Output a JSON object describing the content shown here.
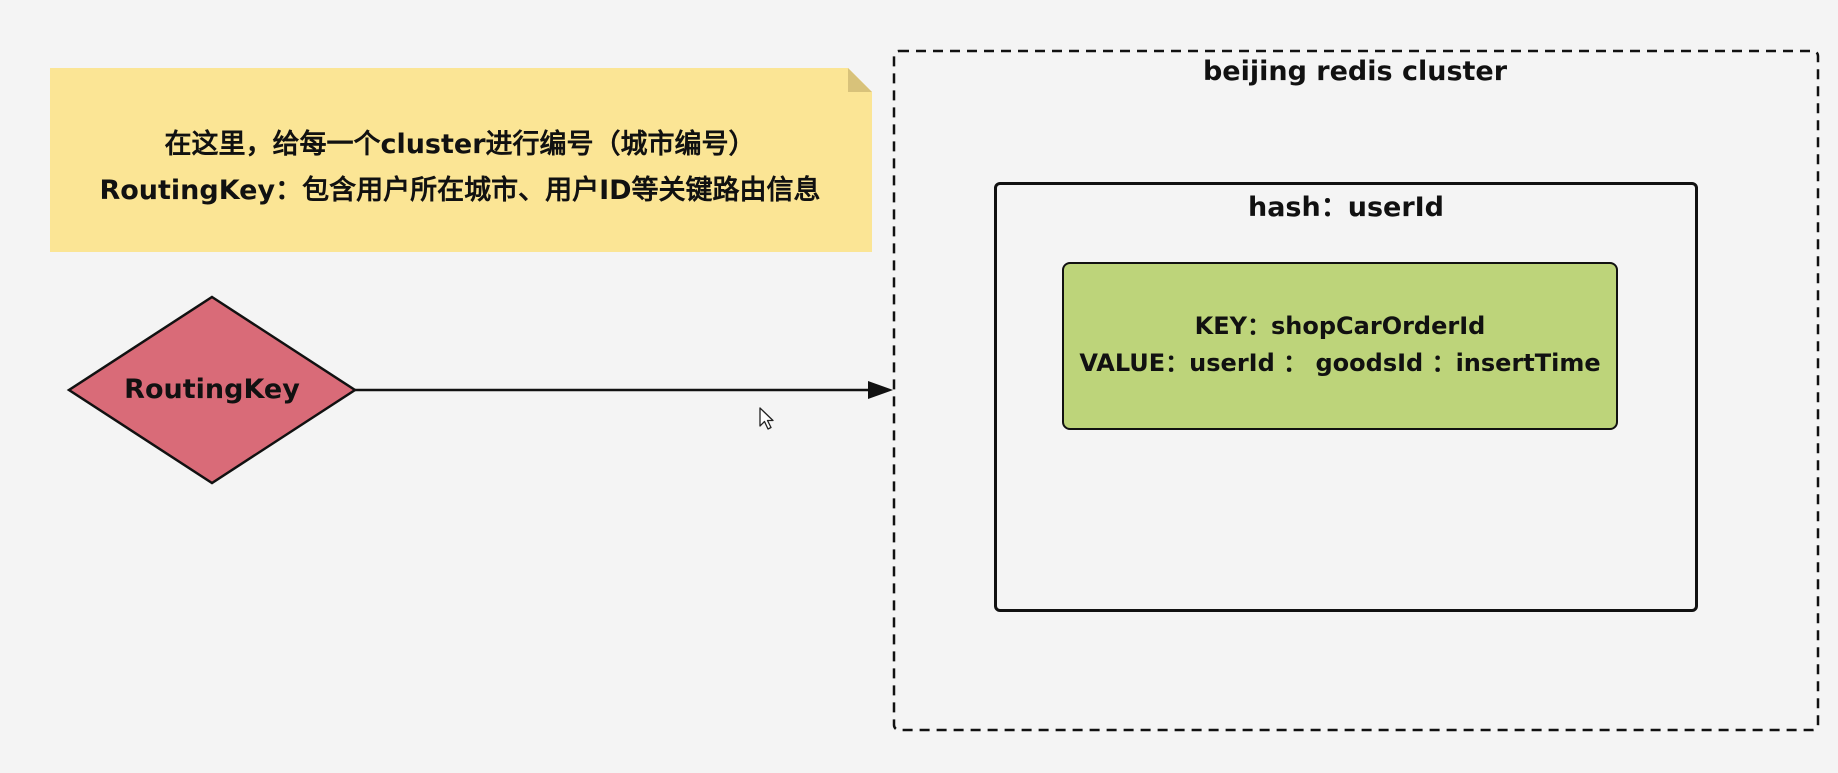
{
  "note": {
    "line1": "在这里，给每一个cluster进行编号（城市编号）",
    "line2": "RoutingKey：包含用户所在城市、用户ID等关键路由信息"
  },
  "routing_key": {
    "label": "RoutingKey"
  },
  "cluster": {
    "title": "beijing redis cluster"
  },
  "hash": {
    "title": "hash：userId"
  },
  "kv": {
    "key_line": "KEY：shopCarOrderId",
    "value_line": "VALUE：userId ： goodsId ：insertTime"
  },
  "colors": {
    "note_fill": "#fbe595",
    "diamond_fill": "#d96b78",
    "kv_fill": "#bdd47a",
    "background": "#f4f4f4"
  },
  "icons": {
    "cursor": "mouse-pointer-icon"
  }
}
